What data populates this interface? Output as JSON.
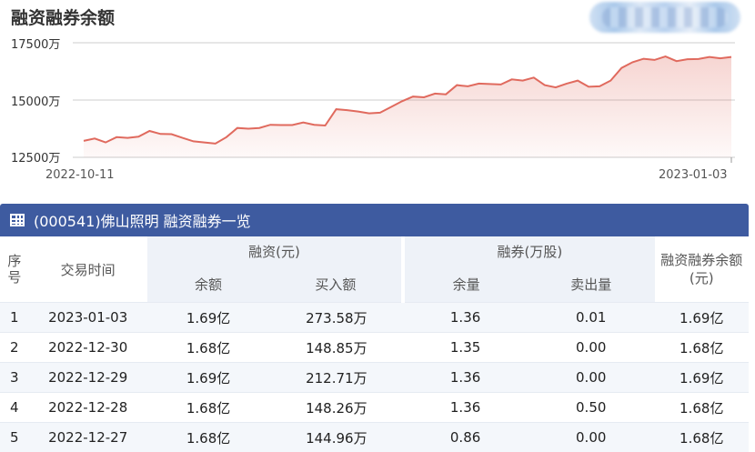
{
  "chart_title": "融资融券余额",
  "chart_data": {
    "type": "area",
    "title": "融资融券余额",
    "y_ticks": [
      "17500万",
      "15000万",
      "12500万"
    ],
    "x_ticks": [
      "2022-10-11",
      "2023-01-03"
    ],
    "ylim": [
      12500,
      17500
    ],
    "unit": "万",
    "color": "#e06a5e",
    "values": [
      13220,
      13320,
      13150,
      13380,
      13350,
      13400,
      13650,
      13520,
      13510,
      13350,
      13200,
      13150,
      13100,
      13380,
      13780,
      13750,
      13780,
      13920,
      13910,
      13910,
      14020,
      13920,
      13890,
      14600,
      14560,
      14500,
      14420,
      14450,
      14700,
      14950,
      15150,
      15120,
      15280,
      15250,
      15650,
      15600,
      15720,
      15700,
      15680,
      15900,
      15850,
      15980,
      15650,
      15550,
      15720,
      15850,
      15580,
      15600,
      15850,
      16400,
      16650,
      16800,
      16750,
      16900,
      16700,
      16780,
      16790,
      16880,
      16820,
      16880
    ]
  },
  "table": {
    "title": "(000541)佛山照明 融资融券一览",
    "headers": {
      "index": "序号",
      "date": "交易时间",
      "margin_group": "融资(元)",
      "short_group": "融券(万股)",
      "total": "融资融券余额(元)",
      "margin_balance": "余额",
      "margin_buy": "买入额",
      "short_balance": "余量",
      "short_sell": "卖出量"
    },
    "rows": [
      {
        "no": "1",
        "date": "2023-01-03",
        "margin_balance": "1.69亿",
        "margin_buy": "273.58万",
        "short_balance": "1.36",
        "short_sell": "0.01",
        "total": "1.69亿"
      },
      {
        "no": "2",
        "date": "2022-12-30",
        "margin_balance": "1.68亿",
        "margin_buy": "148.85万",
        "short_balance": "1.35",
        "short_sell": "0.00",
        "total": "1.68亿"
      },
      {
        "no": "3",
        "date": "2022-12-29",
        "margin_balance": "1.69亿",
        "margin_buy": "212.71万",
        "short_balance": "1.36",
        "short_sell": "0.00",
        "total": "1.69亿"
      },
      {
        "no": "4",
        "date": "2022-12-28",
        "margin_balance": "1.68亿",
        "margin_buy": "148.26万",
        "short_balance": "1.36",
        "short_sell": "0.50",
        "total": "1.68亿"
      },
      {
        "no": "5",
        "date": "2022-12-27",
        "margin_balance": "1.68亿",
        "margin_buy": "144.96万",
        "short_balance": "0.86",
        "short_sell": "0.00",
        "total": "1.68亿"
      }
    ]
  }
}
